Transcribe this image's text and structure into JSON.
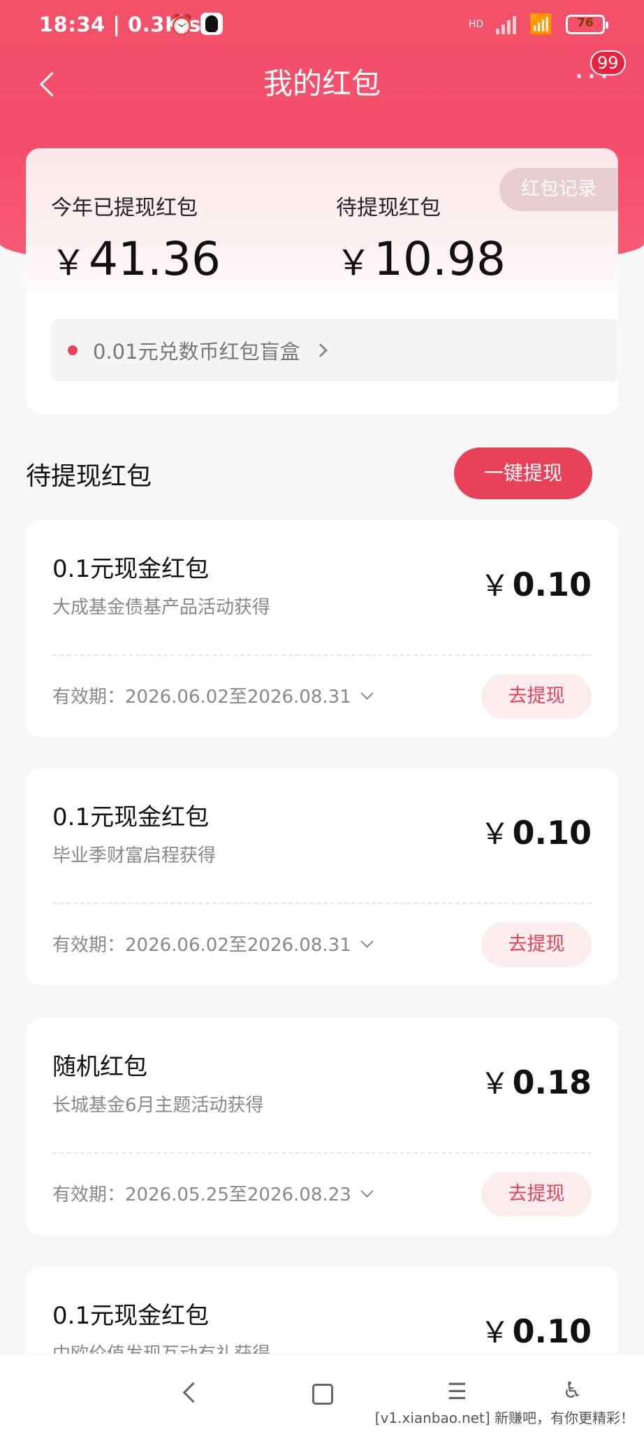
{
  "status_bar": {
    "time": "18:34 | 0.3K/s",
    "battery": "76",
    "network": "HD"
  },
  "nav": {
    "title": "我的红包",
    "more": "···",
    "badge": "99"
  },
  "summary": {
    "record_button": "红包记录",
    "withdrawn_label": "今年已提现红包",
    "withdrawn_amount": "41.36",
    "pending_label": "待提现红包",
    "pending_amount": "10.98",
    "currency": "￥",
    "blind_box_text": "0.01元兑数币红包盲盒"
  },
  "section": {
    "title": "待提现红包",
    "withdraw_all_button": "一键提现"
  },
  "cards": [
    {
      "name": "0.1元现金红包",
      "source": "大成基金债基产品活动获得",
      "price": "0.10",
      "validity": "有效期：2026.06.02至2026.08.31",
      "action": "去提现"
    },
    {
      "name": "0.1元现金红包",
      "source": "毕业季财富启程获得",
      "price": "0.10",
      "validity": "有效期：2026.06.02至2026.08.31",
      "action": "去提现"
    },
    {
      "name": "随机红包",
      "source": "长城基金6月主题活动获得",
      "price": "0.18",
      "validity": "有效期：2026.05.25至2026.08.23",
      "action": "去提现"
    },
    {
      "name": "0.1元现金红包",
      "source": "中欧价值发现互动有礼获得",
      "price": "0.10",
      "validity": "",
      "action": ""
    }
  ],
  "watermark": "[v1.xianbao.net] 新赚吧，有你更精彩！",
  "colors": {
    "accent": "#e8425b",
    "header": "#f54e6b"
  }
}
